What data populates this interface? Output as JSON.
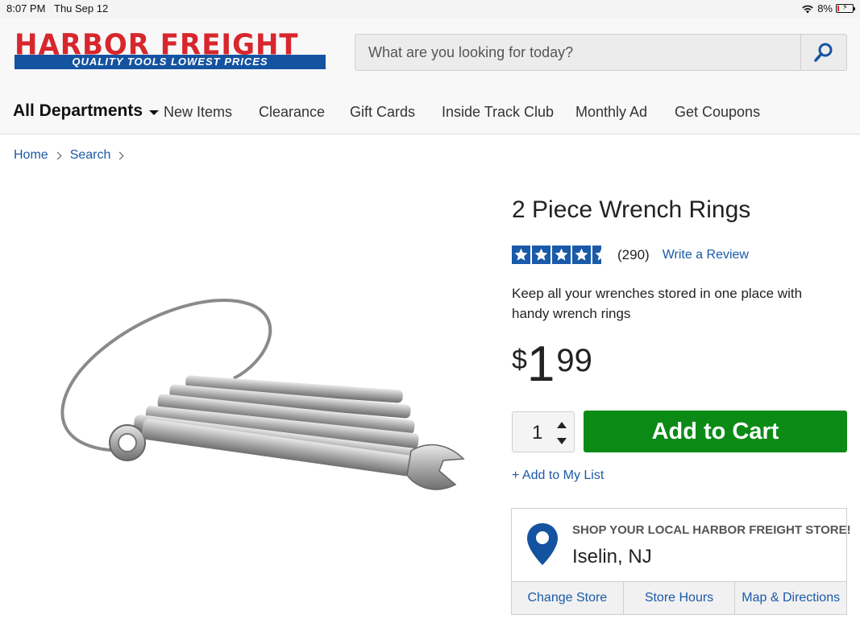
{
  "status_bar": {
    "time": "8:07 PM",
    "date": "Thu Sep 12",
    "battery": "8%",
    "battery_level": 0.08
  },
  "header": {
    "brand": "HARBOR FREIGHT",
    "tagline": "QUALITY TOOLS   LOWEST PRICES",
    "search_placeholder": "What are you looking for today?",
    "nav": {
      "all_departments": "All Departments",
      "items": [
        "New Items",
        "Clearance",
        "Gift Cards",
        "Inside Track Club",
        "Monthly Ad",
        "Get Coupons"
      ]
    }
  },
  "breadcrumb": [
    "Home",
    "Search"
  ],
  "product": {
    "title": "2 Piece Wrench Rings",
    "rating": 4.5,
    "review_count": "(290)",
    "write_review": "Write a Review",
    "description": "Keep all your wrenches stored in one place with handy wrench rings",
    "price": {
      "currency": "$",
      "dollars": "1",
      "cents": "99"
    },
    "quantity": "1",
    "add_to_cart": "Add to Cart",
    "add_to_list": "+ Add to My List"
  },
  "store": {
    "heading": "SHOP YOUR LOCAL HARBOR FREIGHT STORE!",
    "city": "Iselin, NJ",
    "links": [
      "Change Store",
      "Store Hours",
      "Map & Directions"
    ]
  },
  "colors": {
    "brand_red": "#d8262d",
    "brand_blue": "#1453a0",
    "link_blue": "#1a5aa8",
    "cart_green": "#0b8a16"
  }
}
